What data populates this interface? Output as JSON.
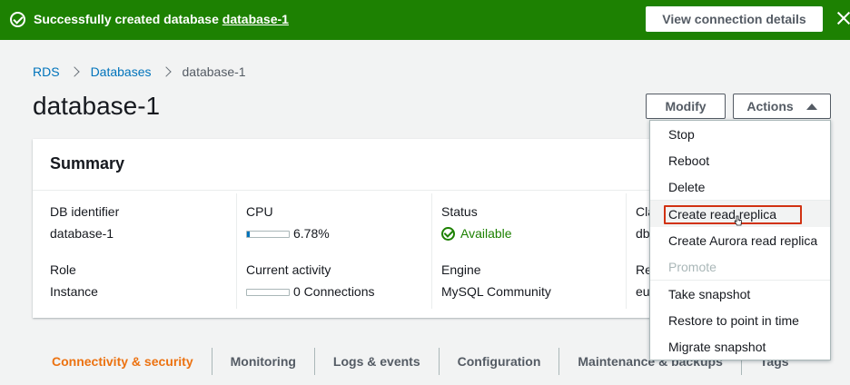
{
  "banner": {
    "message_prefix": "Successfully created database ",
    "database_link": "database-1",
    "view_connection_label": "View connection details"
  },
  "breadcrumb": {
    "items": [
      "RDS",
      "Databases",
      "database-1"
    ]
  },
  "page": {
    "title": "database-1",
    "modify_label": "Modify",
    "actions_label": "Actions"
  },
  "summary": {
    "title": "Summary",
    "db_identifier_label": "DB identifier",
    "db_identifier_value": "database-1",
    "role_label": "Role",
    "role_value": "Instance",
    "cpu_label": "CPU",
    "cpu_value": "6.78%",
    "cpu_fraction": 0.0678,
    "activity_label": "Current activity",
    "activity_value": "0 Connections",
    "activity_fraction": 0,
    "status_label": "Status",
    "status_value": "Available",
    "engine_label": "Engine",
    "engine_value": "MySQL Community",
    "class_label_partial": "Cla",
    "class_value_partial": "db",
    "region_label_partial": "Re",
    "region_value_partial": "eu"
  },
  "tabs": [
    "Connectivity & security",
    "Monitoring",
    "Logs & events",
    "Configuration",
    "Maintenance & backups",
    "Tags"
  ],
  "actions_menu": {
    "items": [
      {
        "label": "Stop",
        "disabled": false
      },
      {
        "label": "Reboot",
        "disabled": false
      },
      {
        "label": "Delete",
        "disabled": false
      },
      {
        "label": "Create read replica",
        "disabled": false
      },
      {
        "label": "Create Aurora read replica",
        "disabled": false
      },
      {
        "label": "Promote",
        "disabled": true
      },
      {
        "label": "Take snapshot",
        "disabled": false
      },
      {
        "label": "Restore to point in time",
        "disabled": false
      },
      {
        "label": "Migrate snapshot",
        "disabled": false
      }
    ]
  },
  "colors": {
    "success_green": "#1d8102",
    "link_blue": "#0073bb",
    "active_tab_orange": "#ec7211",
    "highlight_red": "#d13212"
  }
}
